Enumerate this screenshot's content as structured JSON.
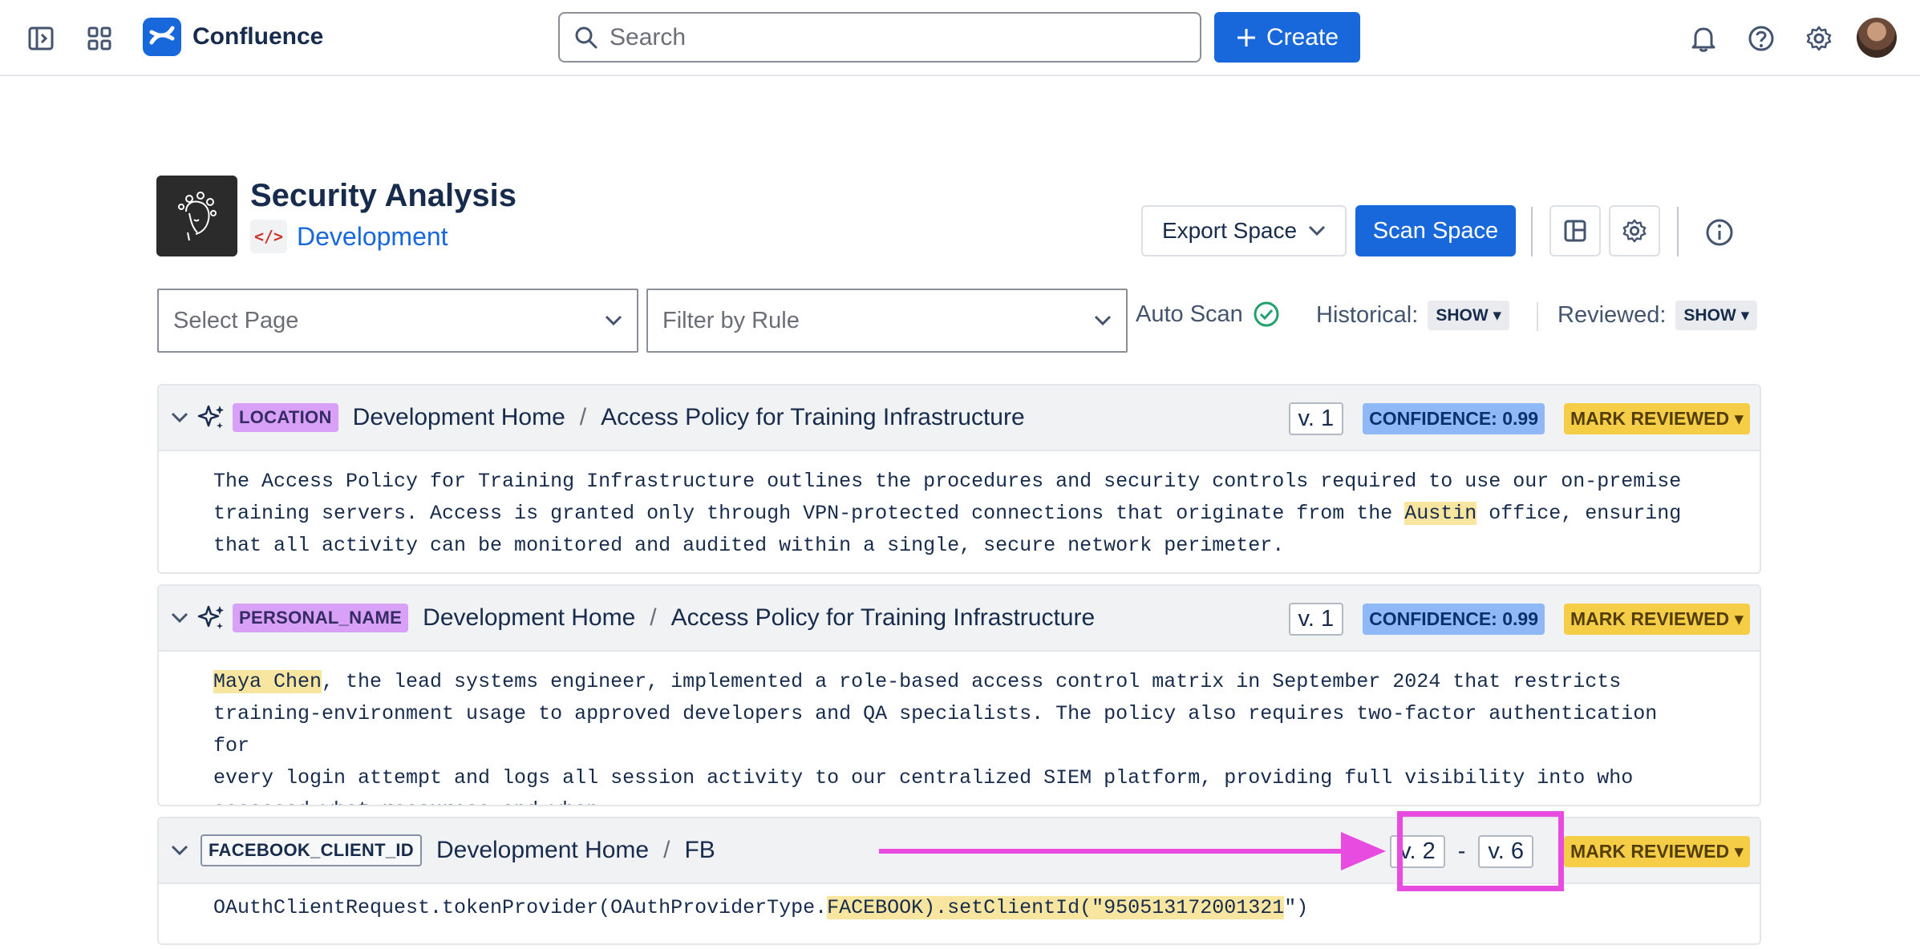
{
  "nav": {
    "app_name": "Confluence",
    "search_placeholder": "Search",
    "create_label": "Create"
  },
  "space": {
    "title": "Security Analysis",
    "code_glyph": "</>",
    "name": "Development",
    "export_label": "Export Space",
    "scan_label": "Scan Space"
  },
  "filters": {
    "page_placeholder": "Select Page",
    "rule_placeholder": "Filter by Rule",
    "auto_scan_label": "Auto Scan",
    "historical_label": "Historical:",
    "historical_value": "SHOW ▾",
    "reviewed_label": "Reviewed:",
    "reviewed_value": "SHOW ▾"
  },
  "findings": [
    {
      "tag": "LOCATION",
      "crumb_root": "Development Home",
      "crumb_sep": "/",
      "page": "Access Policy for Training Infrastructure",
      "version": "v. 1",
      "confidence": "CONFIDENCE: 0.99",
      "mark": "MARK REVIEWED ▾",
      "text_a": "The Access Policy for Training Infrastructure outlines the procedures and security controls required to use our on-premise\ntraining servers. Access is granted only through VPN-protected connections that originate from the ",
      "text_hl": "Austin",
      "text_b": " office, ensuring\nthat all activity can be monitored and audited within a single, secure network perimeter."
    },
    {
      "tag": "PERSONAL_NAME",
      "crumb_root": "Development Home",
      "crumb_sep": "/",
      "page": "Access Policy for Training Infrastructure",
      "version": "v. 1",
      "confidence": "CONFIDENCE: 0.99",
      "mark": "MARK REVIEWED ▾",
      "text_hl": "Maya Chen",
      "text_b": ", the lead systems engineer, implemented a role-based access control matrix in September 2024 that restricts\ntraining-environment usage to approved developers and QA specialists. The policy also requires two-factor authentication for\nevery login attempt and logs all session activity to our centralized SIEM platform, providing full visibility into who\naccessed what resources and when."
    },
    {
      "tag": "FACEBOOK_CLIENT_ID",
      "crumb_root": "Development Home",
      "crumb_sep": "/",
      "page": "FB",
      "version_from": "v. 2",
      "version_dash": "-",
      "version_to": "v. 6",
      "mark": "MARK REVIEWED ▾",
      "text_a": "OAuthClientRequest.tokenProvider(OAuthProviderType.",
      "text_hl": "FACEBOOK).setClientId(\"950513172001321",
      "text_b": "\")"
    }
  ],
  "colors": {
    "primary": "#1868db",
    "highlight": "#f8e6a0",
    "annotation": "#e84be0",
    "tag_purple": "#d8a0f7",
    "confidence_blue": "#8fb8f6",
    "mark_yellow": "#f5cd47",
    "success_green": "#22a06b"
  },
  "icons": [
    "sidebar-toggle-icon",
    "app-switcher-icon",
    "search-icon",
    "plus-icon",
    "bell-icon",
    "help-icon",
    "settings-icon",
    "chevron-down-icon",
    "layout-icon",
    "info-icon",
    "check-circle-icon",
    "sparkle-icon"
  ]
}
